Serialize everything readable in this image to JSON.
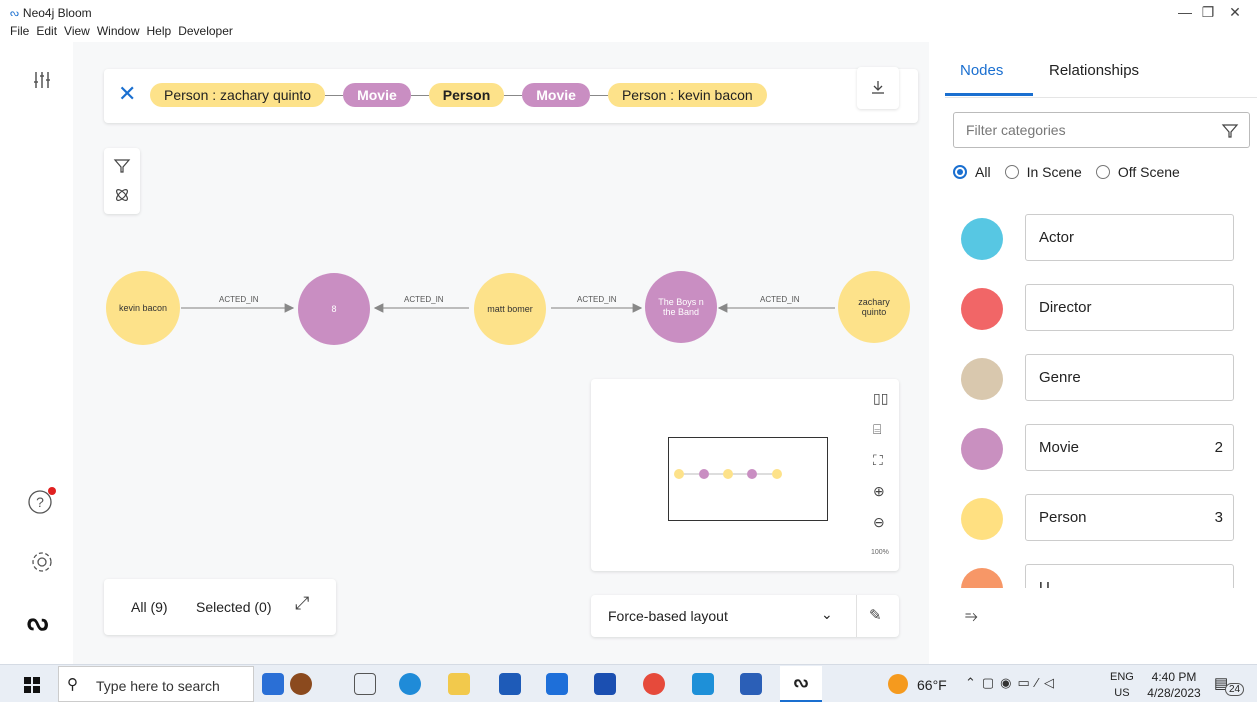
{
  "window": {
    "app_title": "Neo4j Bloom",
    "minimize": "—",
    "restore": "❐",
    "close": "✕"
  },
  "menu": [
    "File",
    "Edit",
    "View",
    "Window",
    "Help",
    "Developer"
  ],
  "search": {
    "pills": [
      {
        "label": "Person : zachary quinto",
        "kind": "person"
      },
      {
        "label": "Movie",
        "kind": "movie"
      },
      {
        "label": "Person",
        "kind": "person-bold"
      },
      {
        "label": "Movie",
        "kind": "movie"
      },
      {
        "label": "Person : kevin bacon",
        "kind": "person"
      }
    ]
  },
  "graph": {
    "nodes": [
      {
        "label": "kevin bacon",
        "type": "Person"
      },
      {
        "label": "8",
        "type": "Movie"
      },
      {
        "label": "matt bomer",
        "type": "Person"
      },
      {
        "label": "The Boys n the Band",
        "type": "Movie"
      },
      {
        "label": "zachary quinto",
        "type": "Person"
      }
    ],
    "relationships": [
      "ACTED_IN",
      "ACTED_IN",
      "ACTED_IN",
      "ACTED_IN"
    ]
  },
  "minimap": {
    "zoom": "100%"
  },
  "selection": {
    "all": "All (9)",
    "selected": "Selected (0)"
  },
  "layout_select": {
    "value": "Force-based layout"
  },
  "panel": {
    "tabs": [
      "Nodes",
      "Relationships"
    ],
    "filter_placeholder": "Filter categories",
    "radios": [
      "All",
      "In Scene",
      "Off Scene"
    ],
    "categories": [
      {
        "name": "Actor",
        "count": "",
        "color": "#57c7e3"
      },
      {
        "name": "Director",
        "count": "",
        "color": "#f16667"
      },
      {
        "name": "Genre",
        "count": "",
        "color": "#d9c8ae"
      },
      {
        "name": "Movie",
        "count": "2",
        "color": "#c990c0"
      },
      {
        "name": "Person",
        "count": "3",
        "color": "#ffe081"
      },
      {
        "name": "U",
        "count": "",
        "color": "#f79767"
      }
    ]
  },
  "taskbar": {
    "search_placeholder": "Type here to search",
    "weather": "66°F",
    "lang": "ENG",
    "region": "US",
    "time": "4:40 PM",
    "date": "4/28/2023",
    "notifications": "24"
  },
  "colors": {
    "person": "#fde28a",
    "movie": "#c98ec2",
    "accent": "#1a6fd0"
  }
}
